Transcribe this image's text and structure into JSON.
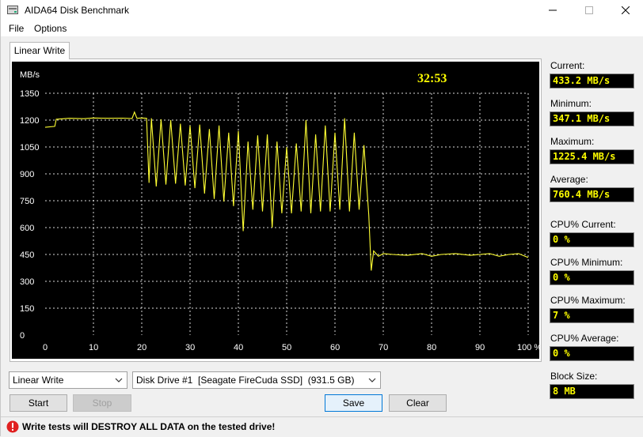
{
  "window": {
    "title": "AIDA64 Disk Benchmark"
  },
  "menu": {
    "file": "File",
    "options": "Options"
  },
  "tab": {
    "label": "Linear Write"
  },
  "chart_data": {
    "type": "line",
    "ylabel": "MB/s",
    "timer": "32:53",
    "ylim": [
      0,
      1350
    ],
    "xlim": [
      0,
      100
    ],
    "y_ticks": [
      "0",
      "150",
      "300",
      "450",
      "600",
      "750",
      "900",
      "1050",
      "1200",
      "1350"
    ],
    "x_ticks": [
      "0",
      "10",
      "20",
      "30",
      "40",
      "50",
      "60",
      "70",
      "80",
      "90",
      "100 %"
    ],
    "grid": true,
    "colors": {
      "background": "#000000",
      "grid": "#ffffff",
      "line": "#ffff33",
      "labels": "#ffffff",
      "timer": "#ffff00"
    },
    "series": [
      {
        "x": [
          0,
          2,
          2.3,
          5,
          8,
          10,
          13,
          16,
          18,
          18.5,
          19,
          20,
          21,
          21.5,
          22,
          23,
          24,
          25,
          26,
          27,
          28,
          29,
          30,
          31,
          32,
          33,
          34,
          35,
          36,
          37,
          38,
          39,
          40,
          41,
          42,
          43,
          44,
          45,
          46,
          47,
          48,
          49,
          50,
          51,
          52,
          53,
          54,
          55,
          56,
          57,
          58,
          59,
          60,
          61,
          62,
          63,
          64,
          65,
          66,
          67,
          67.5,
          68,
          69,
          70,
          72,
          75,
          78,
          80,
          82,
          85,
          88,
          90,
          92,
          94,
          96,
          98,
          100
        ],
        "y": [
          1160,
          1165,
          1205,
          1210,
          1208,
          1212,
          1210,
          1211,
          1209,
          1245,
          1210,
          1212,
          1210,
          850,
          1210,
          830,
          1205,
          840,
          1200,
          845,
          1180,
          835,
          1170,
          820,
          1175,
          790,
          1150,
          760,
          1170,
          745,
          1130,
          720,
          1140,
          580,
          1080,
          700,
          1115,
          690,
          1120,
          600,
          1080,
          680,
          1050,
          680,
          1070,
          690,
          1200,
          680,
          1120,
          690,
          1170,
          690,
          1130,
          700,
          1210,
          690,
          1130,
          700,
          1060,
          670,
          360,
          470,
          440,
          455,
          450,
          445,
          455,
          440,
          450,
          455,
          445,
          450,
          455,
          440,
          450,
          455,
          433
        ]
      }
    ]
  },
  "stats": {
    "current": {
      "label": "Current:",
      "value": "433.2 MB/s"
    },
    "minimum": {
      "label": "Minimum:",
      "value": "347.1 MB/s"
    },
    "maximum": {
      "label": "Maximum:",
      "value": "1225.4 MB/s"
    },
    "average": {
      "label": "Average:",
      "value": "760.4 MB/s"
    },
    "cpu_current": {
      "label": "CPU% Current:",
      "value": "0 %"
    },
    "cpu_minimum": {
      "label": "CPU% Minimum:",
      "value": "0 %"
    },
    "cpu_maximum": {
      "label": "CPU% Maximum:",
      "value": "7 %"
    },
    "cpu_average": {
      "label": "CPU% Average:",
      "value": "0 %"
    },
    "block_size": {
      "label": "Block Size:",
      "value": "8 MB"
    }
  },
  "controls": {
    "test_select": "Linear Write",
    "drive_select": "Disk Drive #1  [Seagate FireCuda SSD]  (931.5 GB)",
    "start": "Start",
    "stop": "Stop",
    "save": "Save",
    "clear": "Clear"
  },
  "status": {
    "warning": "Write tests will DESTROY ALL DATA on the tested drive!"
  }
}
